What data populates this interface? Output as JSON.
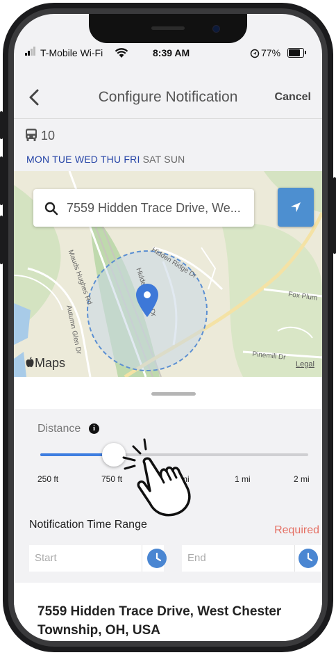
{
  "status_bar": {
    "carrier": "T-Mobile Wi-Fi",
    "time": "8:39 AM",
    "battery": "77%",
    "icons": [
      "signal-icon",
      "wifi-icon",
      "location-lock-icon",
      "battery-icon"
    ]
  },
  "header": {
    "title": "Configure Notification",
    "cancel_label": "Cancel",
    "back_icon": "chevron-left-icon"
  },
  "route": {
    "icon": "bus-icon",
    "number": "10",
    "days": [
      {
        "label": "MON",
        "active": true
      },
      {
        "label": "TUE",
        "active": true
      },
      {
        "label": "WED",
        "active": true
      },
      {
        "label": "THU",
        "active": true
      },
      {
        "label": "FRI",
        "active": true
      },
      {
        "label": "SAT",
        "active": false
      },
      {
        "label": "SUN",
        "active": false
      }
    ]
  },
  "map": {
    "search_value": "7559 Hidden Trace Drive, We...",
    "search_icon": "search-icon",
    "locate_icon": "navigation-arrow-icon",
    "maps_label": "Maps",
    "legal_label": "Legal",
    "roads": [
      "Mauds Hughes Rd",
      "Hidden Ridge Dr",
      "Hidden Trace Dr",
      "Autumn Glen Dr",
      "Fox Plum",
      "Pinemill Dr"
    ]
  },
  "distance": {
    "label": "Distance",
    "info_icon": "info-icon",
    "ticks": [
      "250 ft",
      "750 ft",
      "mi",
      "1 mi",
      "2 mi"
    ],
    "selected_index": 1,
    "slider_fraction": 0.275
  },
  "time_range": {
    "label": "Notification Time Range",
    "required_label": "Required",
    "start_placeholder": "Start",
    "end_placeholder": "End"
  },
  "address": {
    "text": "7559 Hidden Trace Drive, West Chester Township, OH, USA"
  },
  "colors": {
    "accent": "#3f7ee0",
    "locate_button": "#4d8fd0",
    "day_active": "#2443a6",
    "required": "#e57064"
  }
}
